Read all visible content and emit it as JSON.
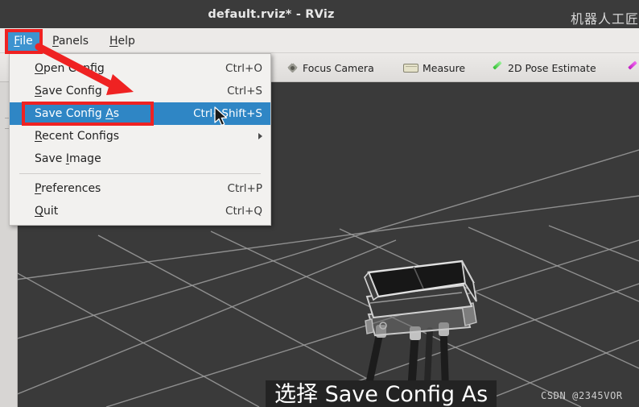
{
  "window": {
    "title": "default.rviz* - RViz",
    "cn_watermark": "机器人工匠"
  },
  "menubar": {
    "items": [
      {
        "label": "File",
        "mnemonic": "F",
        "active": true
      },
      {
        "label": "Panels",
        "mnemonic": "P",
        "active": false
      },
      {
        "label": "Help",
        "mnemonic": "H",
        "active": false
      }
    ]
  },
  "toolbar": {
    "buttons": [
      {
        "label": "Focus Camera",
        "icon": "focus-camera-icon"
      },
      {
        "label": "Measure",
        "icon": "ruler-icon"
      },
      {
        "label": "2D Pose Estimate",
        "icon": "green-arrow-icon"
      },
      {
        "label": "",
        "icon": "magenta-arrow-icon"
      }
    ]
  },
  "file_menu": {
    "items": [
      {
        "label": "Open Config",
        "mnemonic": "O",
        "shortcut": "Ctrl+O",
        "selected": false,
        "submenu": false
      },
      {
        "label": "Save Config",
        "mnemonic": "S",
        "shortcut": "Ctrl+S",
        "selected": false,
        "submenu": false
      },
      {
        "label": "Save Config As",
        "mnemonic": "A",
        "shortcut": "Ctrl+Shift+S",
        "selected": true,
        "submenu": false
      },
      {
        "label": "Recent Configs",
        "mnemonic": "R",
        "shortcut": "",
        "selected": false,
        "submenu": true
      },
      {
        "label": "Save Image",
        "mnemonic": "I",
        "shortcut": "",
        "selected": false,
        "submenu": false
      },
      {
        "label": "Preferences",
        "mnemonic": "P",
        "shortcut": "Ctrl+P",
        "selected": false,
        "submenu": false
      },
      {
        "label": "Quit",
        "mnemonic": "Q",
        "shortcut": "Ctrl+Q",
        "selected": false,
        "submenu": false
      }
    ],
    "separator_after_index": 4
  },
  "viewport": {
    "caption": "选择 Save Config As",
    "watermark": "CSDN @2345VOR",
    "background_color": "#3a3a3a",
    "grid_color": "#9a9a9a",
    "robot_label": "quadruped-robot-model"
  },
  "annotations": {
    "highlight_boxes": [
      "File",
      "Save Config As"
    ],
    "arrow_color": "#ef2222",
    "box_color": "#ef2222"
  }
}
